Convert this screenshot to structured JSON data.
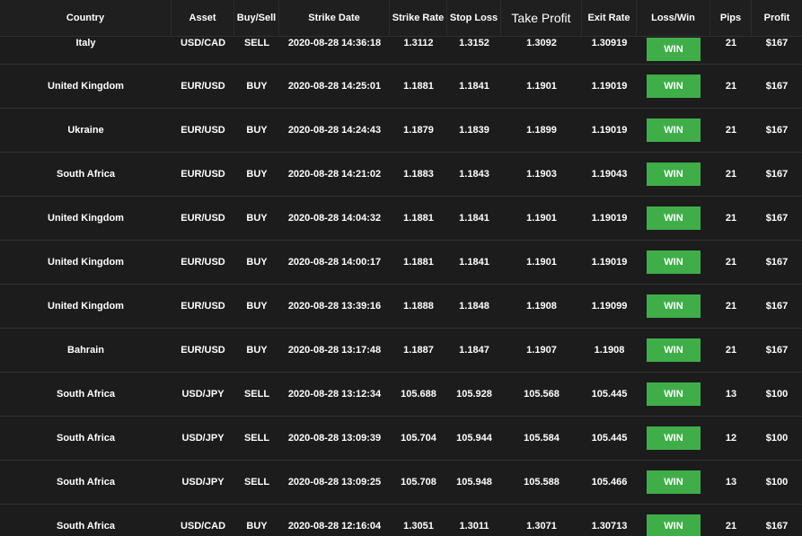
{
  "table": {
    "headers": {
      "country": "Country",
      "asset": "Asset",
      "buy_sell": "Buy/Sell",
      "strike_date": "Strike Date",
      "strike_rate": "Strike Rate",
      "stop_loss": "Stop Loss",
      "take_profit": "Take Profit",
      "exit_rate": "Exit Rate",
      "loss_win": "Loss/Win",
      "pips": "Pips",
      "profit": "Profit"
    },
    "rows": [
      {
        "country": "Italy",
        "asset": "USD/CAD",
        "side": "SELL",
        "date": "2020-08-28 14:36:18",
        "strike": "1.3112",
        "stop": "1.3152",
        "take": "1.3092",
        "exit": "1.30919",
        "result": "WIN",
        "pips": "21",
        "profit": "$167"
      },
      {
        "country": "United Kingdom",
        "asset": "EUR/USD",
        "side": "BUY",
        "date": "2020-08-28 14:25:01",
        "strike": "1.1881",
        "stop": "1.1841",
        "take": "1.1901",
        "exit": "1.19019",
        "result": "WIN",
        "pips": "21",
        "profit": "$167"
      },
      {
        "country": "Ukraine",
        "asset": "EUR/USD",
        "side": "BUY",
        "date": "2020-08-28 14:24:43",
        "strike": "1.1879",
        "stop": "1.1839",
        "take": "1.1899",
        "exit": "1.19019",
        "result": "WIN",
        "pips": "21",
        "profit": "$167"
      },
      {
        "country": "South Africa",
        "asset": "EUR/USD",
        "side": "BUY",
        "date": "2020-08-28 14:21:02",
        "strike": "1.1883",
        "stop": "1.1843",
        "take": "1.1903",
        "exit": "1.19043",
        "result": "WIN",
        "pips": "21",
        "profit": "$167"
      },
      {
        "country": "United Kingdom",
        "asset": "EUR/USD",
        "side": "BUY",
        "date": "2020-08-28 14:04:32",
        "strike": "1.1881",
        "stop": "1.1841",
        "take": "1.1901",
        "exit": "1.19019",
        "result": "WIN",
        "pips": "21",
        "profit": "$167"
      },
      {
        "country": "United Kingdom",
        "asset": "EUR/USD",
        "side": "BUY",
        "date": "2020-08-28 14:00:17",
        "strike": "1.1881",
        "stop": "1.1841",
        "take": "1.1901",
        "exit": "1.19019",
        "result": "WIN",
        "pips": "21",
        "profit": "$167"
      },
      {
        "country": "United Kingdom",
        "asset": "EUR/USD",
        "side": "BUY",
        "date": "2020-08-28 13:39:16",
        "strike": "1.1888",
        "stop": "1.1848",
        "take": "1.1908",
        "exit": "1.19099",
        "result": "WIN",
        "pips": "21",
        "profit": "$167"
      },
      {
        "country": "Bahrain",
        "asset": "EUR/USD",
        "side": "BUY",
        "date": "2020-08-28 13:17:48",
        "strike": "1.1887",
        "stop": "1.1847",
        "take": "1.1907",
        "exit": "1.1908",
        "result": "WIN",
        "pips": "21",
        "profit": "$167"
      },
      {
        "country": "South Africa",
        "asset": "USD/JPY",
        "side": "SELL",
        "date": "2020-08-28 13:12:34",
        "strike": "105.688",
        "stop": "105.928",
        "take": "105.568",
        "exit": "105.445",
        "result": "WIN",
        "pips": "13",
        "profit": "$100"
      },
      {
        "country": "South Africa",
        "asset": "USD/JPY",
        "side": "SELL",
        "date": "2020-08-28 13:09:39",
        "strike": "105.704",
        "stop": "105.944",
        "take": "105.584",
        "exit": "105.445",
        "result": "WIN",
        "pips": "12",
        "profit": "$100"
      },
      {
        "country": "South Africa",
        "asset": "USD/JPY",
        "side": "SELL",
        "date": "2020-08-28 13:09:25",
        "strike": "105.708",
        "stop": "105.948",
        "take": "105.588",
        "exit": "105.466",
        "result": "WIN",
        "pips": "13",
        "profit": "$100"
      },
      {
        "country": "South Africa",
        "asset": "USD/CAD",
        "side": "BUY",
        "date": "2020-08-28 12:16:04",
        "strike": "1.3051",
        "stop": "1.3011",
        "take": "1.3071",
        "exit": "1.30713",
        "result": "WIN",
        "pips": "21",
        "profit": "$167"
      }
    ]
  },
  "colors": {
    "background": "#1c1c1c",
    "win_badge": "#3fae49",
    "row_divider": "#313131",
    "text": "#ffffff"
  }
}
